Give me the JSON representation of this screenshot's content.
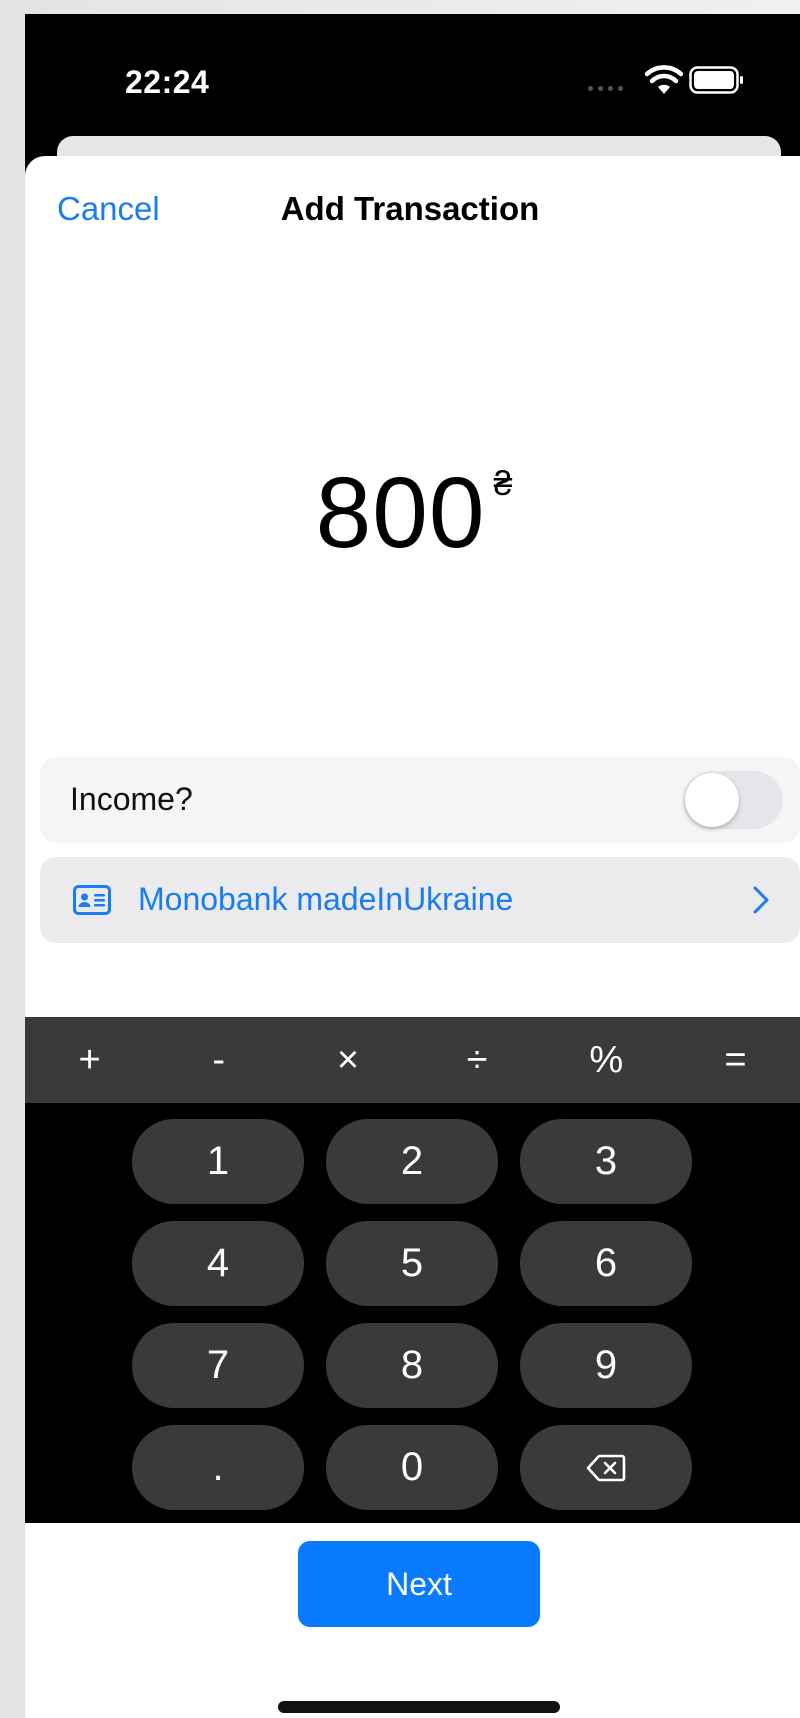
{
  "status_bar": {
    "time": "22:24"
  },
  "nav": {
    "cancel_label": "Cancel",
    "title": "Add Transaction"
  },
  "amount": {
    "value": "800",
    "currency_symbol": "₴"
  },
  "income_row": {
    "label": "Income?",
    "toggle_on": false
  },
  "account_row": {
    "label": "Monobank madeInUkraine",
    "icon": "id-card-icon"
  },
  "operators": [
    "+",
    "-",
    "×",
    "÷",
    "%",
    "="
  ],
  "keypad": {
    "k1": "1",
    "k2": "2",
    "k3": "3",
    "k4": "4",
    "k5": "5",
    "k6": "6",
    "k7": "7",
    "k8": "8",
    "k9": "9",
    "dot": ".",
    "k0": "0",
    "backspace_icon": "backspace-icon"
  },
  "next_button": {
    "label": "Next"
  },
  "colors": {
    "accent": "#1a7cf4",
    "button_blue": "#0a7aff",
    "key_bg": "#3a3a3c"
  }
}
